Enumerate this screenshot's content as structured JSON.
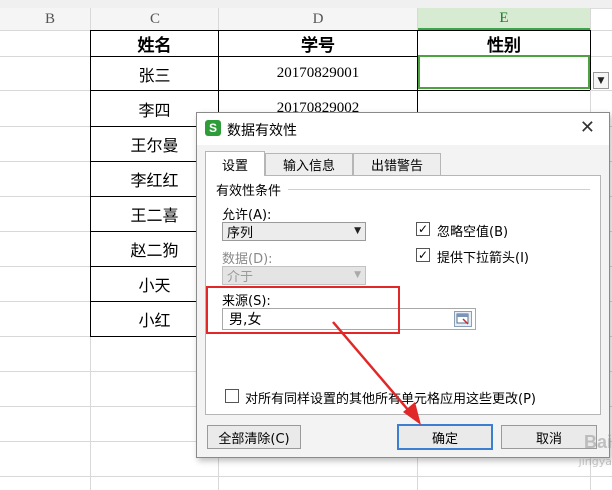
{
  "sheet": {
    "columns": [
      "B",
      "C",
      "D",
      "E"
    ],
    "headers": {
      "name": "姓名",
      "id": "学号",
      "gender": "性别"
    },
    "rows": [
      {
        "name": "张三",
        "id": "20170829001"
      },
      {
        "name": "李四",
        "id": "20170829002"
      },
      {
        "name": "王尔曼",
        "id": ""
      },
      {
        "name": "李红红",
        "id": ""
      },
      {
        "name": "王二喜",
        "id": ""
      },
      {
        "name": "赵二狗",
        "id": ""
      },
      {
        "name": "小天",
        "id": ""
      },
      {
        "name": "小红",
        "id": ""
      }
    ]
  },
  "dialog": {
    "icon": "S",
    "title": "数据有效性",
    "close": "✕",
    "tabs": [
      "设置",
      "输入信息",
      "出错警告"
    ],
    "group_label": "有效性条件",
    "allow_label": "允许(A):",
    "allow_value": "序列",
    "data_label": "数据(D):",
    "data_value": "介于",
    "ignore_blank_label": "忽略空值(B)",
    "ignore_blank_checked": "✓",
    "dropdown_label": "提供下拉箭头(I)",
    "dropdown_checked": "✓",
    "source_label": "来源(S):",
    "source_value": "男,女",
    "apply_all_label": "对所有同样设置的其他所有单元格应用这些更改(P)",
    "clear_all_button": "全部清除(C)",
    "ok_button": "确定",
    "cancel_button": "取消"
  },
  "watermark": {
    "main": "Bai",
    "sub": "jingya"
  },
  "colors": {
    "selection": "#4ca23f",
    "highlight": "#e02828",
    "primary_button": "#3c7fd0"
  }
}
